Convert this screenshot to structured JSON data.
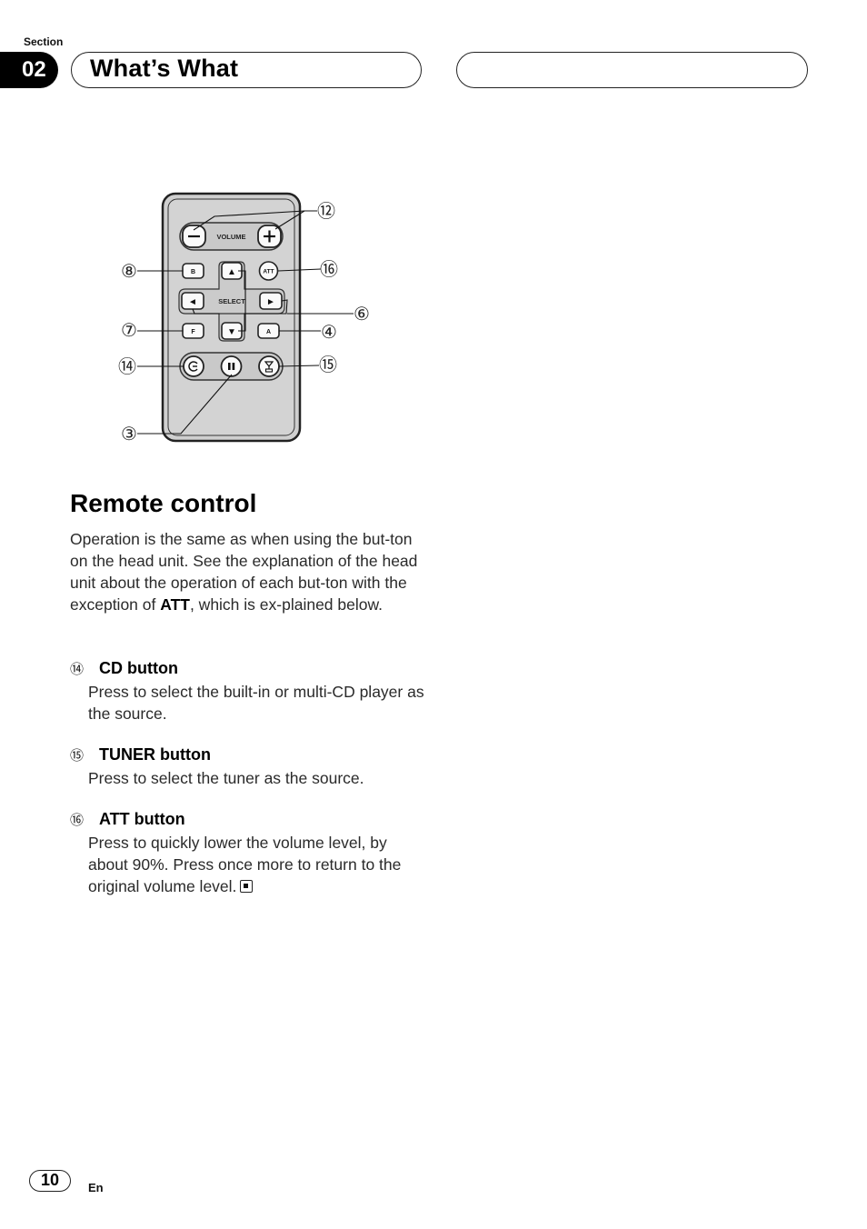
{
  "header": {
    "section_label": "Section",
    "section_number": "02",
    "section_title": "What’s What"
  },
  "figure": {
    "remote": {
      "volume_label": "VOLUME",
      "select_label": "SELECT",
      "buttons": {
        "volume_down": "−",
        "volume_up": "+",
        "b": "B",
        "up": "▲",
        "att": "ATT",
        "left": "◄",
        "right": "►",
        "f": "F",
        "down": "▼",
        "a": "A",
        "cd_icon": "cd-source-icon",
        "pause_icon": "pause-icon",
        "tuner_icon": "tuner-antenna-icon"
      }
    },
    "callouts": {
      "volume": "⑫",
      "b": "⑧",
      "att": "⑯",
      "select": "⑥",
      "f": "⑦",
      "a": "④",
      "cd": "⑭",
      "tuner": "⑮",
      "pause": "③"
    }
  },
  "main": {
    "heading": "Remote control",
    "intro_before": "Operation is the same as when using the but-ton on the head unit. See the explanation of the head unit about the operation of each but-ton with the exception of ",
    "intro_bold": "ATT",
    "intro_after": ", which is ex-plained below.",
    "items": [
      {
        "num": "⑭",
        "title": "CD button",
        "desc": "Press to select the built-in or multi-CD player as the source."
      },
      {
        "num": "⑮",
        "title": "TUNER button",
        "desc": "Press to select the tuner as the source."
      },
      {
        "num": "⑯",
        "title": "ATT button",
        "desc": "Press to quickly lower the volume level, by about 90%. Press once more to return to the original volume level."
      }
    ]
  },
  "footer": {
    "page_number": "10",
    "language": "En"
  }
}
